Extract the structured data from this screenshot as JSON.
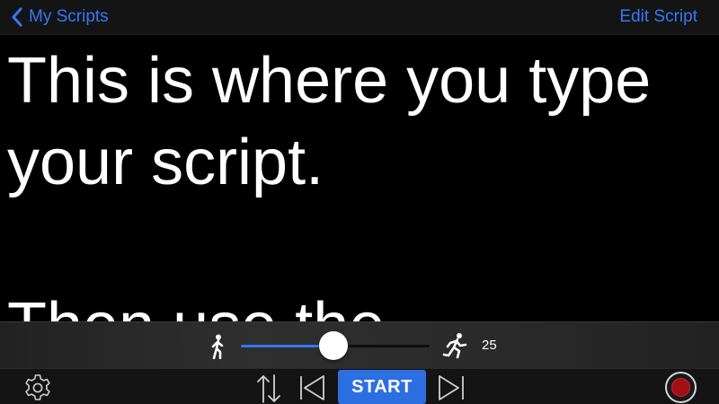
{
  "navbar": {
    "back_label": "My Scripts",
    "edit_label": "Edit Script"
  },
  "script": {
    "text": "This is where you type your script.\n\nThen use the"
  },
  "speed": {
    "value": "25",
    "slider_fraction": 0.49
  },
  "toolbar": {
    "start_label": "START",
    "icons": [
      "gear-icon",
      "swap-arrows-icon",
      "skip-back-icon",
      "skip-forward-icon",
      "record-icon"
    ]
  },
  "colors": {
    "accent": "#3478f6",
    "start_button": "#2c6fe0",
    "record": "#a10f18",
    "background": "#000000"
  }
}
